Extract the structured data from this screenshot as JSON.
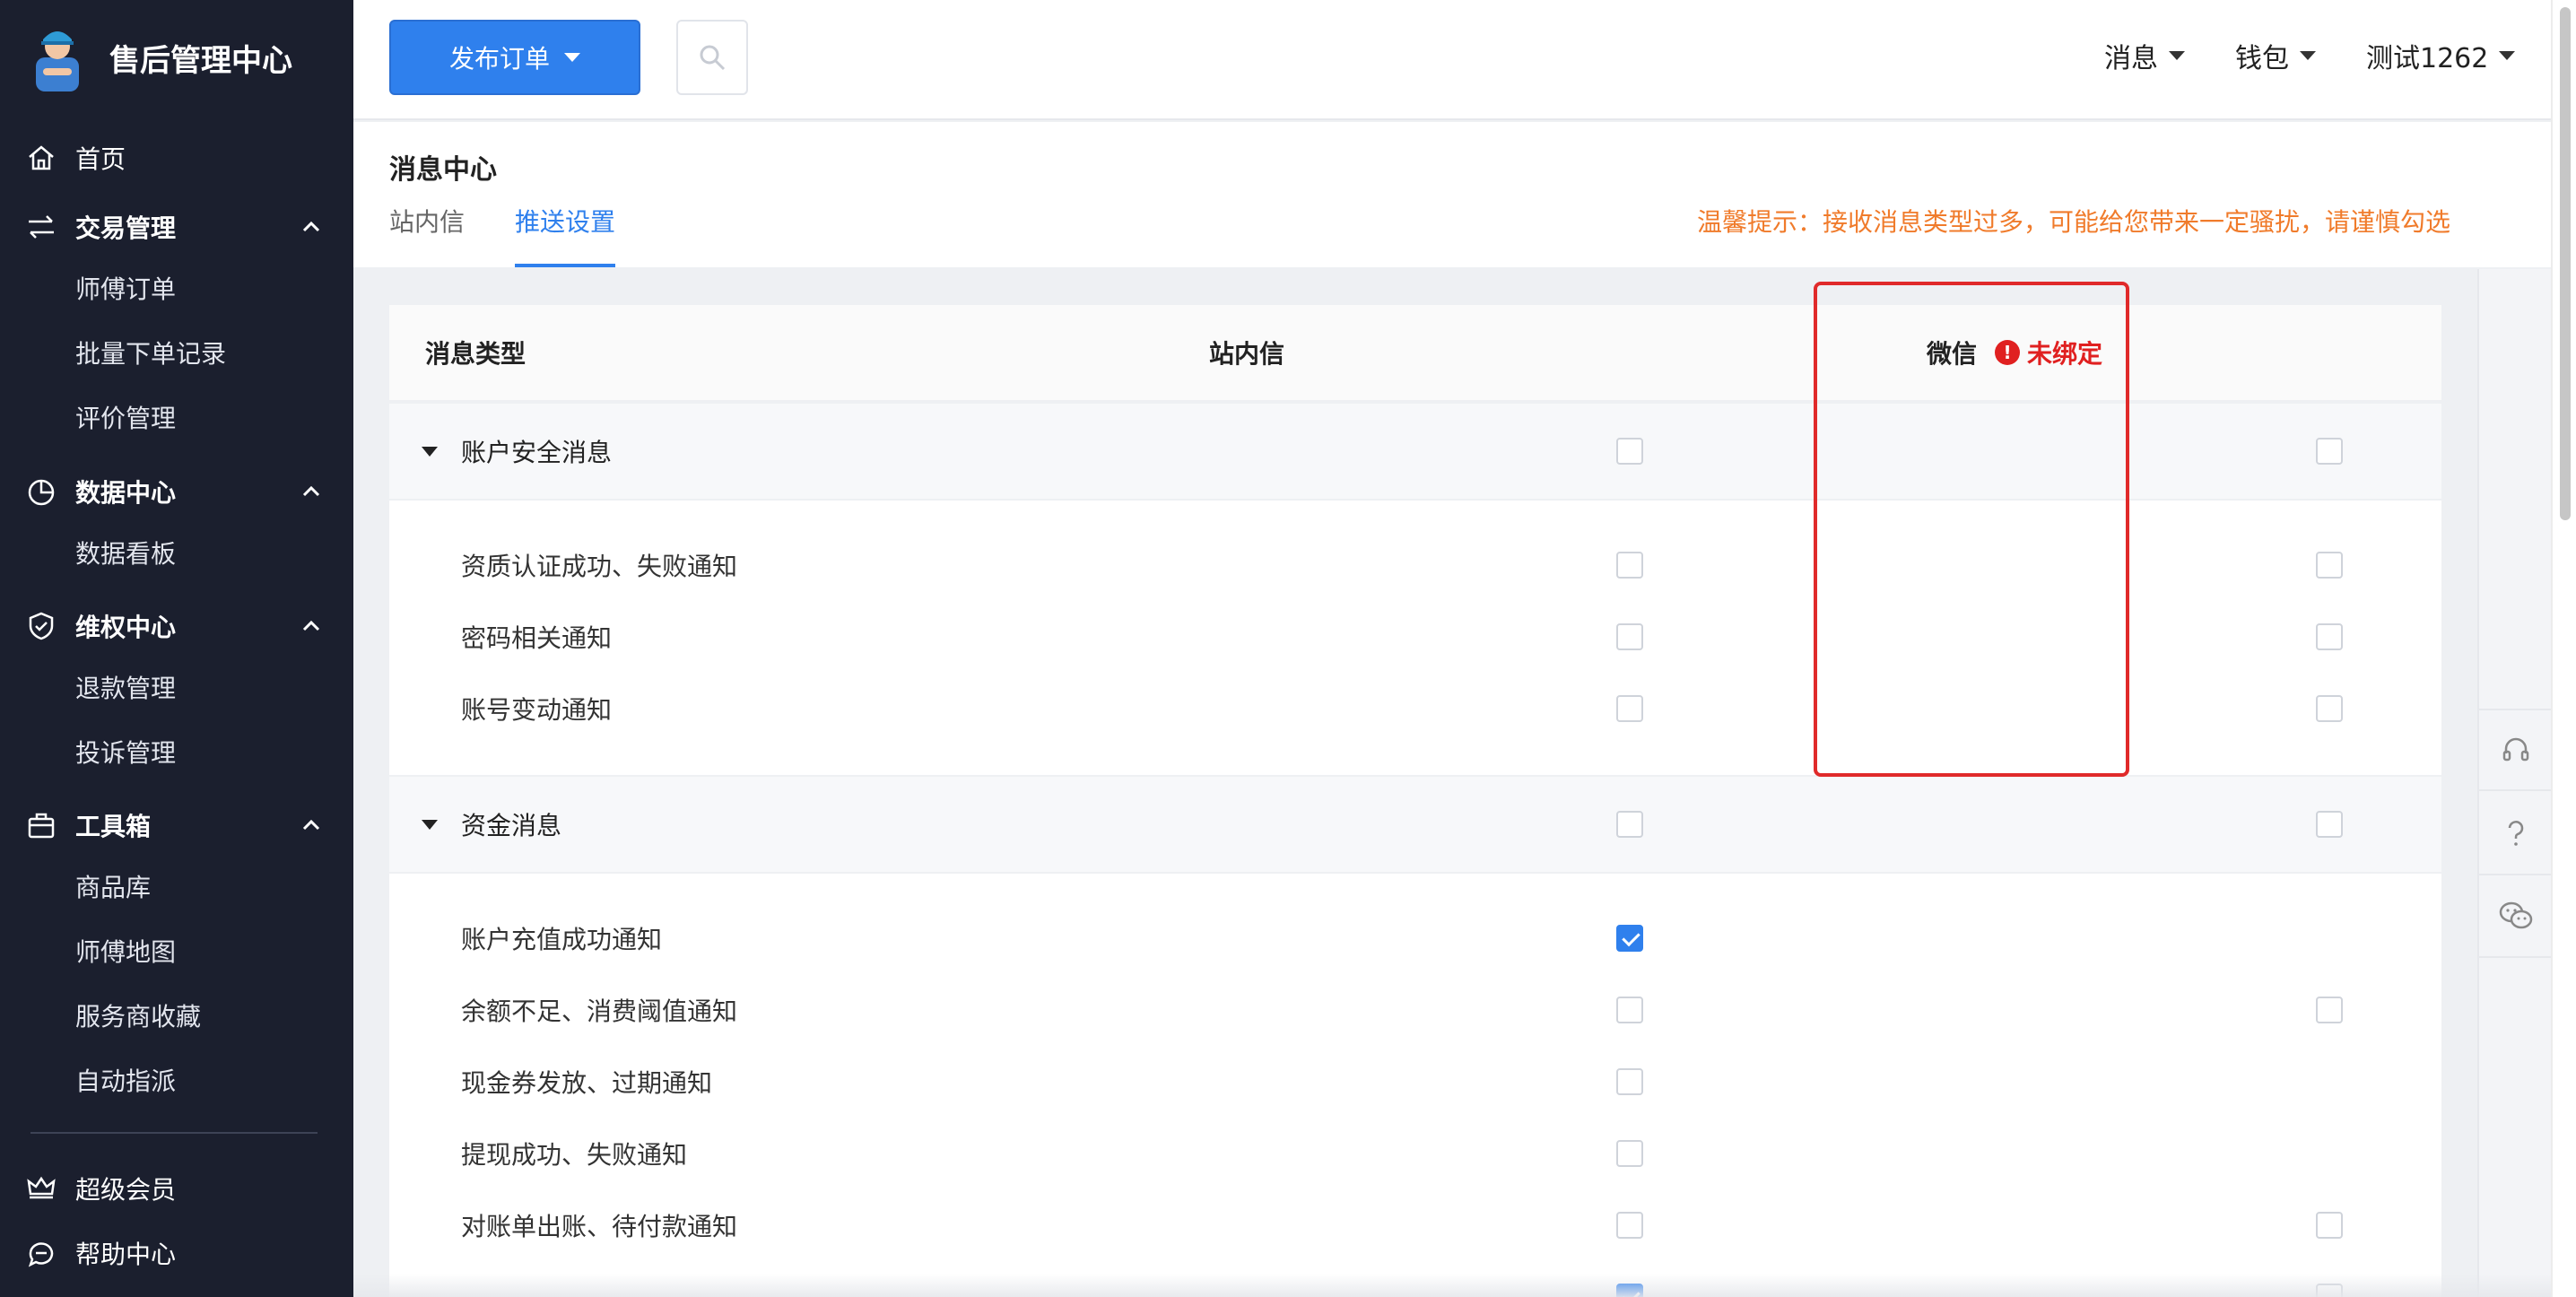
{
  "brand": {
    "title": "售后管理中心"
  },
  "sidebar": {
    "home": "首页",
    "groups": [
      {
        "label": "交易管理",
        "items": [
          "师傅订单",
          "批量下单记录",
          "评价管理"
        ]
      },
      {
        "label": "数据中心",
        "items": [
          "数据看板"
        ]
      },
      {
        "label": "维权中心",
        "items": [
          "退款管理",
          "投诉管理"
        ]
      },
      {
        "label": "工具箱",
        "items": [
          "商品库",
          "师傅地图",
          "服务商收藏",
          "自动指派"
        ]
      }
    ],
    "bottom": [
      "超级会员",
      "帮助中心"
    ]
  },
  "header": {
    "publish_label": "发布订单",
    "menus": [
      "消息",
      "钱包",
      "测试1262"
    ]
  },
  "page": {
    "title": "消息中心",
    "tabs": [
      "站内信",
      "推送设置"
    ],
    "active_tab": "推送设置",
    "tip": "温馨提示：接收消息类型过多，可能给您带来一定骚扰，请谨慎勾选"
  },
  "table": {
    "headers": {
      "type": "消息类型",
      "inner": "站内信",
      "wechat": "微信",
      "unbound": "未绑定"
    },
    "groups": [
      {
        "name": "账户安全消息",
        "inner": false,
        "wechat": false,
        "items": [
          {
            "name": "资质认证成功、失败通知",
            "inner": false,
            "wechat": false
          },
          {
            "name": "密码相关通知",
            "inner": false,
            "wechat": false
          },
          {
            "name": "账号变动通知",
            "inner": false,
            "wechat": false
          }
        ]
      },
      {
        "name": "资金消息",
        "inner": false,
        "wechat": false,
        "items": [
          {
            "name": "账户充值成功通知",
            "inner": true,
            "wechat": null
          },
          {
            "name": "余额不足、消费阈值通知",
            "inner": false,
            "wechat": false
          },
          {
            "name": "现金券发放、过期通知",
            "inner": false,
            "wechat": null
          },
          {
            "name": "提现成功、失败通知",
            "inner": false,
            "wechat": null
          },
          {
            "name": "对账单出账、待付款通知",
            "inner": false,
            "wechat": false
          }
        ]
      }
    ]
  },
  "colors": {
    "accent": "#2f80ed",
    "sidebar_bg": "#1b1f2e",
    "warning": "#f07b2b",
    "error": "#e02020"
  },
  "icons": [
    "home-icon",
    "exchange-icon",
    "pie-chart-icon",
    "shield-check-icon",
    "toolbox-icon",
    "crown-icon",
    "chat-help-icon",
    "search-icon",
    "headset-icon",
    "question-icon",
    "wechat-icon"
  ]
}
